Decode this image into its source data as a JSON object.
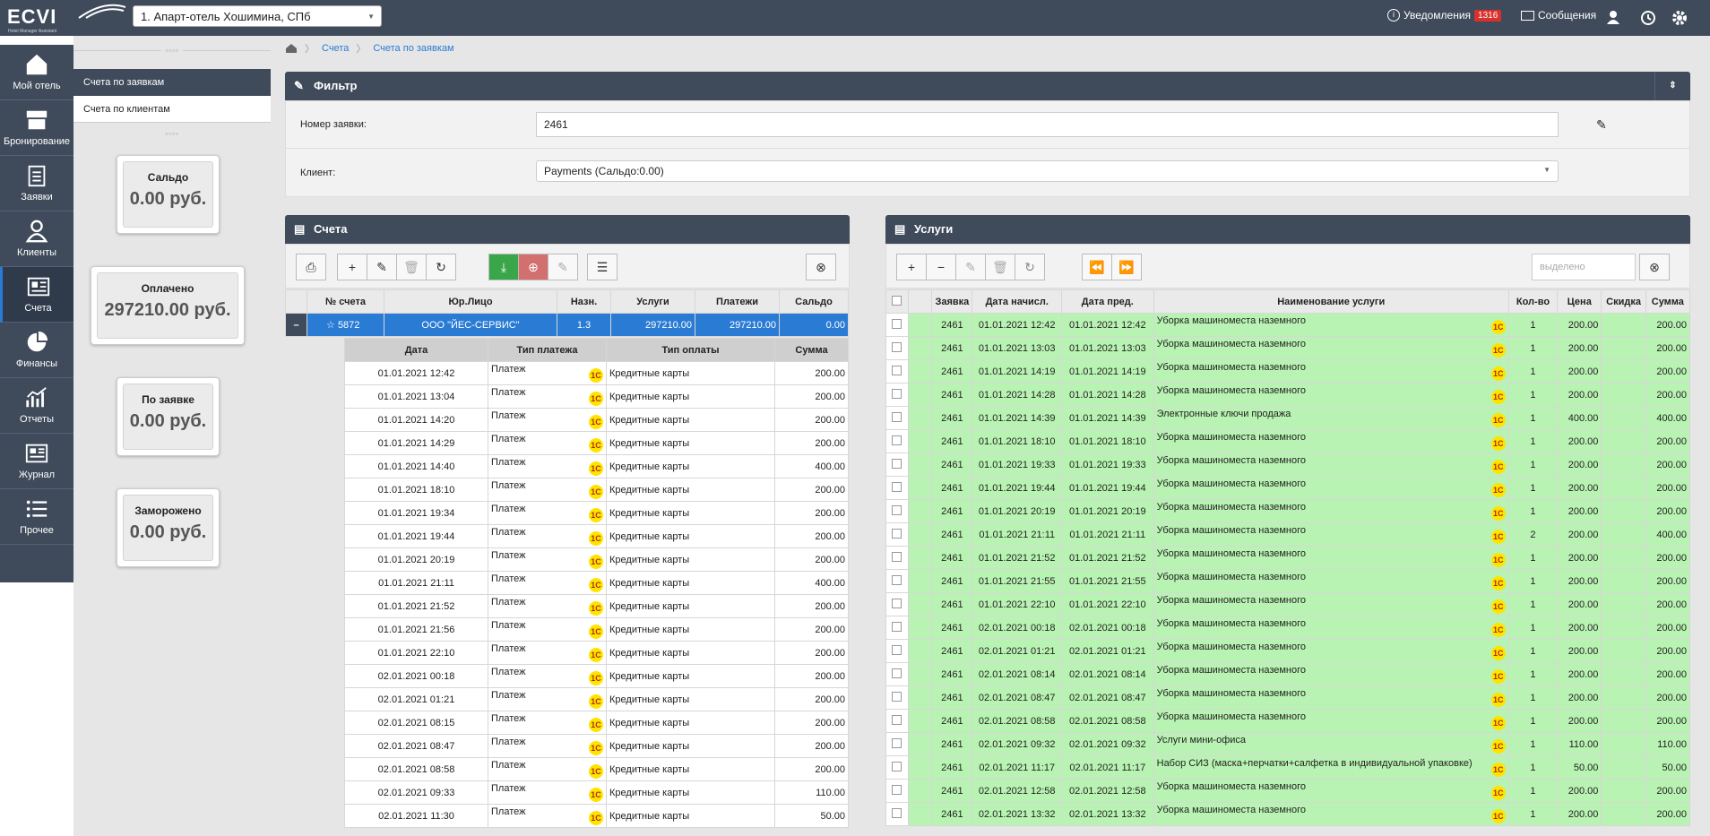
{
  "app": {
    "logo": "ECVI",
    "logo_sub": "Hotel Manager Assistant",
    "hotel": "1. Апарт-отель Хошимина, СПб"
  },
  "topbar": {
    "notifications_label": "Уведомления",
    "notifications_count": "1316",
    "messages_label": "Сообщения"
  },
  "nav": [
    {
      "label": "Мой отель",
      "icon": "home-icon"
    },
    {
      "label": "Бронирование",
      "icon": "archive-icon"
    },
    {
      "label": "Заявки",
      "icon": "clipboard-icon"
    },
    {
      "label": "Клиенты",
      "icon": "user-icon"
    },
    {
      "label": "Счета",
      "icon": "invoice-icon"
    },
    {
      "label": "Финансы",
      "icon": "pie-icon"
    },
    {
      "label": "Отчеты",
      "icon": "chart-icon"
    },
    {
      "label": "Журнал",
      "icon": "journal-icon"
    },
    {
      "label": "Прочее",
      "icon": "list-icon"
    }
  ],
  "submenu": [
    "Счета по заявкам",
    "Счета по клиентам"
  ],
  "stats": [
    {
      "title": "Сальдо",
      "value": "0.00 руб."
    },
    {
      "title": "Оплачено",
      "value": "297210.00 руб."
    },
    {
      "title": "По заявке",
      "value": "0.00 руб."
    },
    {
      "title": "Заморожено",
      "value": "0.00 руб."
    }
  ],
  "breadcrumb": [
    "Счета",
    "Счета по заявкам"
  ],
  "filter": {
    "title": "Фильтр",
    "order_label": "Номер заявки:",
    "order_value": "2461",
    "client_label": "Клиент:",
    "client_value": "Payments (Сальдо:0.00)"
  },
  "accounts": {
    "title": "Счета",
    "columns": [
      "№ счета",
      "Юр.Лицо",
      "Назн.",
      "Услуги",
      "Платежи",
      "Сальдо"
    ],
    "row": {
      "number": "5872",
      "entity": "ООО \"ЙЕС-СЕРВИС\"",
      "purpose": "1.3",
      "services": "297210.00",
      "payments": "297210.00",
      "balance": "0.00"
    },
    "pay_columns": [
      "Дата",
      "Тип платежа",
      "Тип оплаты",
      "Сумма"
    ],
    "payments": [
      [
        "01.01.2021 12:42",
        "Платеж",
        "Кредитные карты",
        "200.00"
      ],
      [
        "01.01.2021 13:04",
        "Платеж",
        "Кредитные карты",
        "200.00"
      ],
      [
        "01.01.2021 14:20",
        "Платеж",
        "Кредитные карты",
        "200.00"
      ],
      [
        "01.01.2021 14:29",
        "Платеж",
        "Кредитные карты",
        "200.00"
      ],
      [
        "01.01.2021 14:40",
        "Платеж",
        "Кредитные карты",
        "400.00"
      ],
      [
        "01.01.2021 18:10",
        "Платеж",
        "Кредитные карты",
        "200.00"
      ],
      [
        "01.01.2021 19:34",
        "Платеж",
        "Кредитные карты",
        "200.00"
      ],
      [
        "01.01.2021 19:44",
        "Платеж",
        "Кредитные карты",
        "200.00"
      ],
      [
        "01.01.2021 20:19",
        "Платеж",
        "Кредитные карты",
        "200.00"
      ],
      [
        "01.01.2021 21:11",
        "Платеж",
        "Кредитные карты",
        "400.00"
      ],
      [
        "01.01.2021 21:52",
        "Платеж",
        "Кредитные карты",
        "200.00"
      ],
      [
        "01.01.2021 21:56",
        "Платеж",
        "Кредитные карты",
        "200.00"
      ],
      [
        "01.01.2021 22:10",
        "Платеж",
        "Кредитные карты",
        "200.00"
      ],
      [
        "02.01.2021 00:18",
        "Платеж",
        "Кредитные карты",
        "200.00"
      ],
      [
        "02.01.2021 01:21",
        "Платеж",
        "Кредитные карты",
        "200.00"
      ],
      [
        "02.01.2021 08:15",
        "Платеж",
        "Кредитные карты",
        "200.00"
      ],
      [
        "02.01.2021 08:47",
        "Платеж",
        "Кредитные карты",
        "200.00"
      ],
      [
        "02.01.2021 08:58",
        "Платеж",
        "Кредитные карты",
        "200.00"
      ],
      [
        "02.01.2021 09:33",
        "Платеж",
        "Кредитные карты",
        "110.00"
      ],
      [
        "02.01.2021 11:30",
        "Платеж",
        "Кредитные карты",
        "50.00"
      ]
    ]
  },
  "services": {
    "title": "Услуги",
    "search_placeholder": "выделено",
    "columns": [
      "Заявка",
      "Дата начисл.",
      "Дата пред.",
      "Наименование услуги",
      "Кол-во",
      "Цена",
      "Скидка",
      "Сумма"
    ],
    "rows": [
      [
        "2461",
        "01.01.2021 12:42",
        "01.01.2021 12:42",
        "Уборка машиноместа наземного",
        "1",
        "200.00",
        "",
        "200.00"
      ],
      [
        "2461",
        "01.01.2021 13:03",
        "01.01.2021 13:03",
        "Уборка машиноместа наземного",
        "1",
        "200.00",
        "",
        "200.00"
      ],
      [
        "2461",
        "01.01.2021 14:19",
        "01.01.2021 14:19",
        "Уборка машиноместа наземного",
        "1",
        "200.00",
        "",
        "200.00"
      ],
      [
        "2461",
        "01.01.2021 14:28",
        "01.01.2021 14:28",
        "Уборка машиноместа наземного",
        "1",
        "200.00",
        "",
        "200.00"
      ],
      [
        "2461",
        "01.01.2021 14:39",
        "01.01.2021 14:39",
        "Электронные ключи продажа",
        "1",
        "400.00",
        "",
        "400.00"
      ],
      [
        "2461",
        "01.01.2021 18:10",
        "01.01.2021 18:10",
        "Уборка машиноместа наземного",
        "1",
        "200.00",
        "",
        "200.00"
      ],
      [
        "2461",
        "01.01.2021 19:33",
        "01.01.2021 19:33",
        "Уборка машиноместа наземного",
        "1",
        "200.00",
        "",
        "200.00"
      ],
      [
        "2461",
        "01.01.2021 19:44",
        "01.01.2021 19:44",
        "Уборка машиноместа наземного",
        "1",
        "200.00",
        "",
        "200.00"
      ],
      [
        "2461",
        "01.01.2021 20:19",
        "01.01.2021 20:19",
        "Уборка машиноместа наземного",
        "1",
        "200.00",
        "",
        "200.00"
      ],
      [
        "2461",
        "01.01.2021 21:11",
        "01.01.2021 21:11",
        "Уборка машиноместа наземного",
        "2",
        "200.00",
        "",
        "400.00"
      ],
      [
        "2461",
        "01.01.2021 21:52",
        "01.01.2021 21:52",
        "Уборка машиноместа наземного",
        "1",
        "200.00",
        "",
        "200.00"
      ],
      [
        "2461",
        "01.01.2021 21:55",
        "01.01.2021 21:55",
        "Уборка машиноместа наземного",
        "1",
        "200.00",
        "",
        "200.00"
      ],
      [
        "2461",
        "01.01.2021 22:10",
        "01.01.2021 22:10",
        "Уборка машиноместа наземного",
        "1",
        "200.00",
        "",
        "200.00"
      ],
      [
        "2461",
        "02.01.2021 00:18",
        "02.01.2021 00:18",
        "Уборка машиноместа наземного",
        "1",
        "200.00",
        "",
        "200.00"
      ],
      [
        "2461",
        "02.01.2021 01:21",
        "02.01.2021 01:21",
        "Уборка машиноместа наземного",
        "1",
        "200.00",
        "",
        "200.00"
      ],
      [
        "2461",
        "02.01.2021 08:14",
        "02.01.2021 08:14",
        "Уборка машиноместа наземного",
        "1",
        "200.00",
        "",
        "200.00"
      ],
      [
        "2461",
        "02.01.2021 08:47",
        "02.01.2021 08:47",
        "Уборка машиноместа наземного",
        "1",
        "200.00",
        "",
        "200.00"
      ],
      [
        "2461",
        "02.01.2021 08:58",
        "02.01.2021 08:58",
        "Уборка машиноместа наземного",
        "1",
        "200.00",
        "",
        "200.00"
      ],
      [
        "2461",
        "02.01.2021 09:32",
        "02.01.2021 09:32",
        "Услуги мини-офиса",
        "1",
        "110.00",
        "",
        "110.00"
      ],
      [
        "2461",
        "02.01.2021 11:17",
        "02.01.2021 11:17",
        "Набор СИЗ (маска+перчатки+салфетка в индивидуальной упаковке)",
        "1",
        "50.00",
        "",
        "50.00"
      ],
      [
        "2461",
        "02.01.2021 12:58",
        "02.01.2021 12:58",
        "Уборка машиноместа наземного",
        "1",
        "200.00",
        "",
        "200.00"
      ],
      [
        "2461",
        "02.01.2021 13:32",
        "02.01.2021 13:32",
        "Уборка машиноместа наземного",
        "1",
        "200.00",
        "",
        "200.00"
      ]
    ]
  },
  "one_c": "1С"
}
